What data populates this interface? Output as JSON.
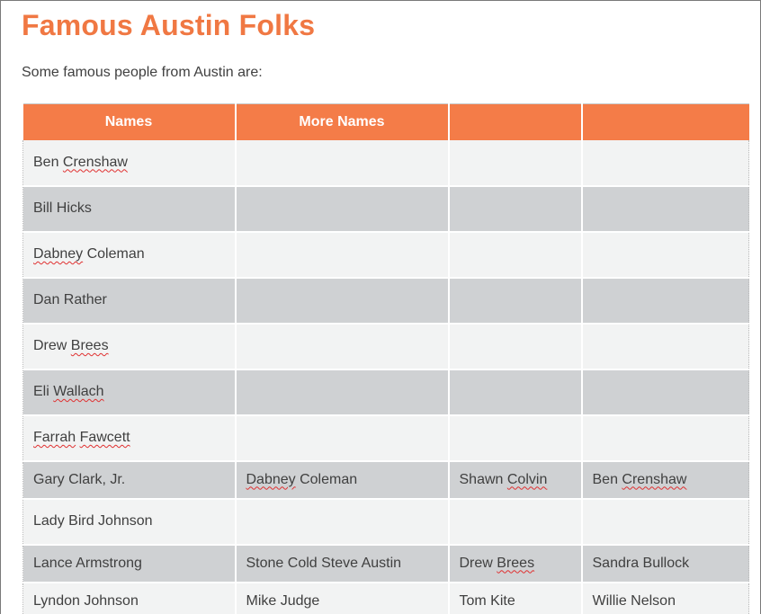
{
  "title": "Famous Austin Folks",
  "intro": "Some famous people from Austin are:",
  "table": {
    "headers": [
      "Names",
      "More Names",
      "",
      ""
    ],
    "rows": [
      [
        [
          {
            "t": "Ben "
          },
          {
            "t": "Crenshaw",
            "s": true
          }
        ],
        [],
        [],
        []
      ],
      [
        [
          {
            "t": "Bill Hicks"
          }
        ],
        [],
        [],
        []
      ],
      [
        [
          {
            "t": "Dabney",
            "s": true
          },
          {
            "t": " Coleman"
          }
        ],
        [],
        [],
        []
      ],
      [
        [
          {
            "t": "Dan Rather"
          }
        ],
        [],
        [],
        []
      ],
      [
        [
          {
            "t": "Drew "
          },
          {
            "t": "Brees",
            "s": true
          }
        ],
        [],
        [],
        []
      ],
      [
        [
          {
            "t": "Eli "
          },
          {
            "t": "Wallach",
            "s": true
          }
        ],
        [],
        [],
        []
      ],
      [
        [
          {
            "t": "Farrah",
            "s": true
          },
          {
            "t": " "
          },
          {
            "t": "Fawcett",
            "s": true
          }
        ],
        [],
        [],
        []
      ],
      [
        [
          {
            "t": "Gary Clark, Jr."
          }
        ],
        [
          {
            "t": "Dabney",
            "s": true
          },
          {
            "t": " Coleman"
          }
        ],
        [
          {
            "t": "Shawn "
          },
          {
            "t": "Colvin",
            "s": true
          }
        ],
        [
          {
            "t": "Ben "
          },
          {
            "t": "Crenshaw",
            "s": true
          }
        ]
      ],
      [
        [
          {
            "t": "Lady Bird Johnson"
          }
        ],
        [],
        [],
        []
      ],
      [
        [
          {
            "t": "Lance Armstrong"
          }
        ],
        [
          {
            "t": "Stone Cold Steve Austin"
          }
        ],
        [
          {
            "t": "Drew "
          },
          {
            "t": "Brees",
            "s": true
          }
        ],
        [
          {
            "t": "Sandra Bullock"
          }
        ]
      ],
      [
        [
          {
            "t": "Lyndon Johnson"
          }
        ],
        [
          {
            "t": "Mike Judge"
          }
        ],
        [
          {
            "t": "Tom Kite"
          }
        ],
        [
          {
            "t": "Willie Nelson"
          }
        ]
      ]
    ]
  },
  "colors": {
    "title": "#f07843",
    "header_bg": "#f47c48",
    "row_light": "#f2f3f3",
    "row_dark": "#cfd1d3",
    "spelling_marker": "#e03030"
  }
}
